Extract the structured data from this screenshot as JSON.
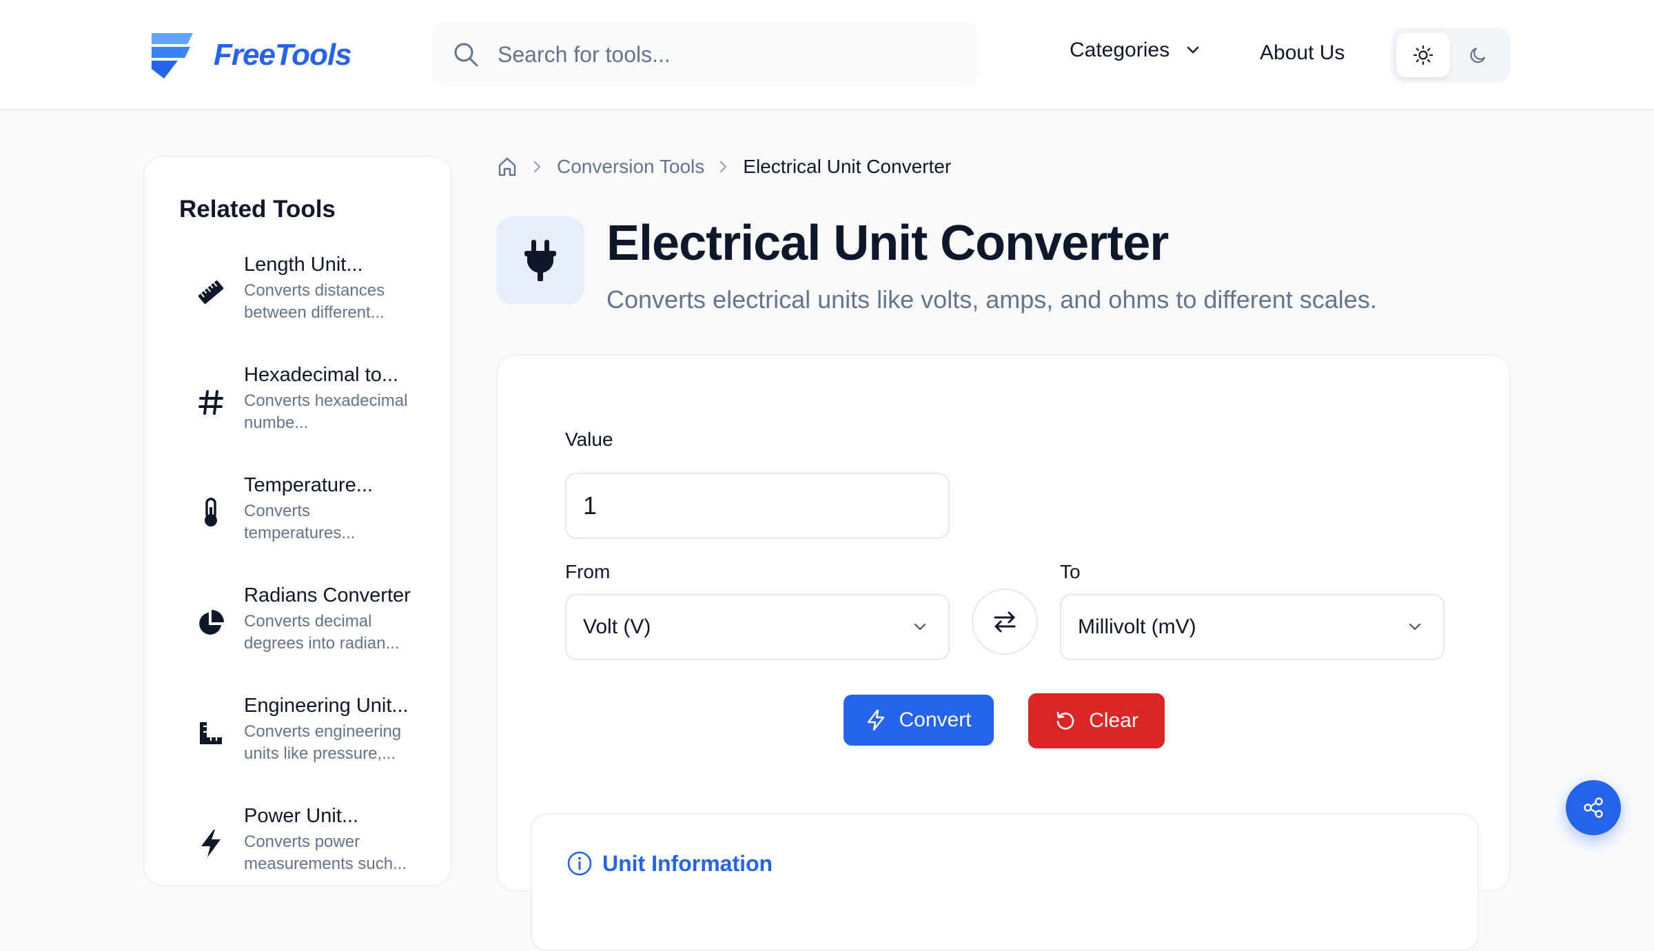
{
  "header": {
    "logo_text": "FreeTools",
    "search_placeholder": "Search for tools...",
    "nav": {
      "categories": "Categories",
      "about": "About Us"
    },
    "theme": {
      "active": "light"
    }
  },
  "sidebar": {
    "title": "Related Tools",
    "items": [
      {
        "name": "Length Unit...",
        "desc": "Converts distances between different...",
        "icon": "ruler-icon"
      },
      {
        "name": "Hexadecimal to...",
        "desc": "Converts hexadecimal numbe...",
        "icon": "hash-icon"
      },
      {
        "name": "Temperature...",
        "desc": "Converts temperatures...",
        "icon": "thermometer-icon"
      },
      {
        "name": "Radians Converter",
        "desc": "Converts decimal degrees into radian...",
        "icon": "pie-chart-icon"
      },
      {
        "name": "Engineering Unit...",
        "desc": "Converts engineering units like pressure,...",
        "icon": "ruler-combined-icon"
      },
      {
        "name": "Power Unit...",
        "desc": "Converts power measurements such...",
        "icon": "bolt-icon"
      }
    ]
  },
  "breadcrumb": {
    "parent": "Conversion Tools",
    "current": "Electrical Unit Converter"
  },
  "page": {
    "title": "Electrical Unit Converter",
    "subtitle": "Converts electrical units like volts, amps, and ohms to different scales."
  },
  "converter": {
    "value_label": "Value",
    "value": "1",
    "from_label": "From",
    "from_value": "Volt (V)",
    "to_label": "To",
    "to_value": "Millivolt (mV)",
    "convert_label": "Convert",
    "clear_label": "Clear"
  },
  "info": {
    "title": "Unit Information"
  },
  "colors": {
    "accent": "#2563eb",
    "danger": "#dc2626",
    "muted": "#64748b"
  }
}
